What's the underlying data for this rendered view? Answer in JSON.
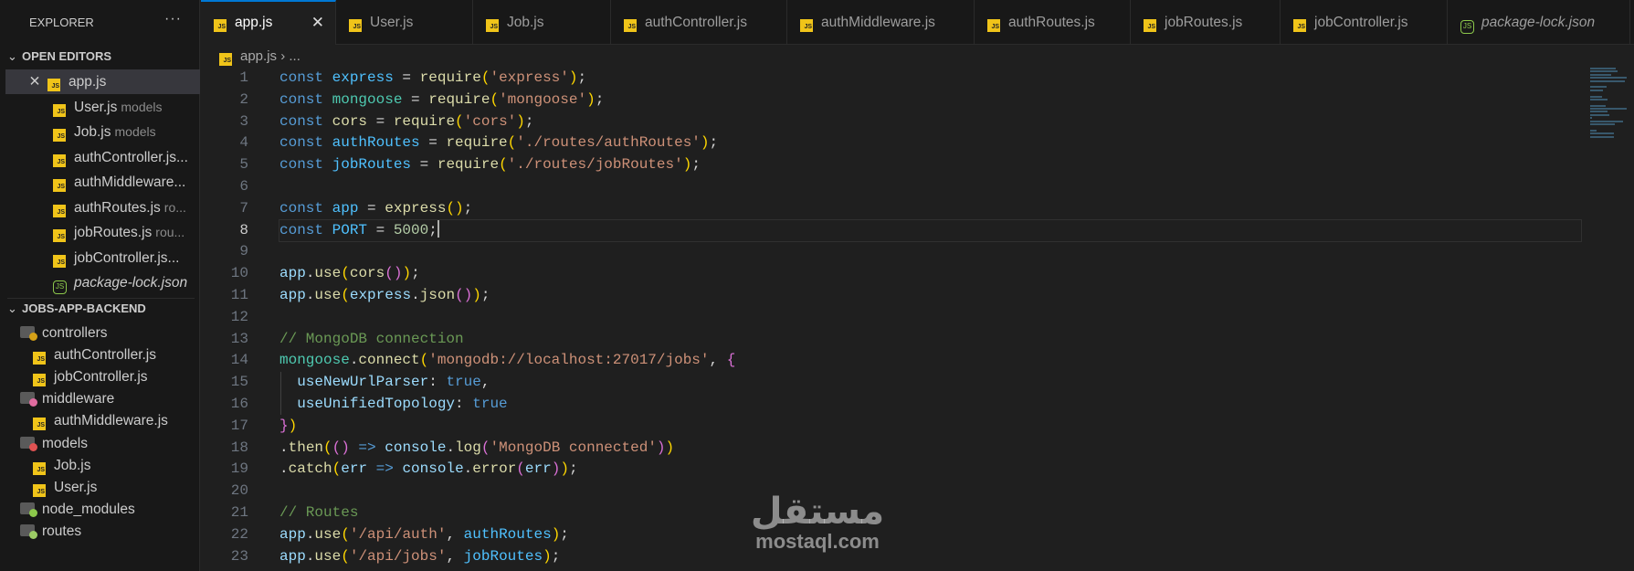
{
  "sidebar": {
    "title": "EXPLORER",
    "more": "···",
    "open_editors": {
      "label": "OPEN EDITORS",
      "items": [
        {
          "name": "app.js",
          "desc": "",
          "icon": "js",
          "selected": true
        },
        {
          "name": "User.js",
          "desc": "models",
          "icon": "js"
        },
        {
          "name": "Job.js",
          "desc": "models",
          "icon": "js"
        },
        {
          "name": "authController.js...",
          "desc": "",
          "icon": "js"
        },
        {
          "name": "authMiddleware...",
          "desc": "",
          "icon": "js"
        },
        {
          "name": "authRoutes.js",
          "desc": "ro...",
          "icon": "js"
        },
        {
          "name": "jobRoutes.js",
          "desc": "rou...",
          "icon": "js"
        },
        {
          "name": "jobController.js...",
          "desc": "",
          "icon": "js"
        },
        {
          "name": "package-lock.json",
          "desc": "",
          "icon": "node",
          "italic": true
        }
      ]
    },
    "project": {
      "label": "JOBS-APP-BACKEND",
      "items": [
        {
          "name": "controllers",
          "type": "folder",
          "badge": "#d4a017",
          "depth": 0
        },
        {
          "name": "authController.js",
          "type": "js",
          "depth": 1
        },
        {
          "name": "jobController.js",
          "type": "js",
          "depth": 1
        },
        {
          "name": "middleware",
          "type": "folder",
          "badge": "#e06c9f",
          "depth": 0
        },
        {
          "name": "authMiddleware.js",
          "type": "js",
          "depth": 1
        },
        {
          "name": "models",
          "type": "folder",
          "badge": "#e05252",
          "depth": 0
        },
        {
          "name": "Job.js",
          "type": "js",
          "depth": 1
        },
        {
          "name": "User.js",
          "type": "js",
          "depth": 1
        },
        {
          "name": "node_modules",
          "type": "folder",
          "badge": "#8cc84b",
          "depth": 0
        },
        {
          "name": "routes",
          "type": "folder",
          "badge": "#9ccc65",
          "depth": 0
        }
      ]
    }
  },
  "tabs": [
    {
      "label": "app.js",
      "icon": "js",
      "active": true
    },
    {
      "label": "User.js",
      "icon": "js"
    },
    {
      "label": "Job.js",
      "icon": "js"
    },
    {
      "label": "authController.js",
      "icon": "js"
    },
    {
      "label": "authMiddleware.js",
      "icon": "js"
    },
    {
      "label": "authRoutes.js",
      "icon": "js"
    },
    {
      "label": "jobRoutes.js",
      "icon": "js"
    },
    {
      "label": "jobController.js",
      "icon": "js"
    },
    {
      "label": "package-lock.json",
      "icon": "node",
      "italic": true
    }
  ],
  "breadcrumb": {
    "file": "app.js",
    "sep": "›",
    "rest": "..."
  },
  "editor": {
    "current_line": 8,
    "lines": [
      [
        [
          "const ",
          "kw"
        ],
        [
          "express",
          "cv"
        ],
        [
          " = ",
          "pl"
        ],
        [
          "require",
          "fn"
        ],
        [
          "(",
          "p1"
        ],
        [
          "'express'",
          "st"
        ],
        [
          ")",
          "p1"
        ],
        [
          ";",
          "pl"
        ]
      ],
      [
        [
          "const ",
          "kw"
        ],
        [
          "mongoose",
          "cl"
        ],
        [
          " = ",
          "pl"
        ],
        [
          "require",
          "fn"
        ],
        [
          "(",
          "p1"
        ],
        [
          "'mongoose'",
          "st"
        ],
        [
          ")",
          "p1"
        ],
        [
          ";",
          "pl"
        ]
      ],
      [
        [
          "const ",
          "kw"
        ],
        [
          "cors",
          "fn"
        ],
        [
          " = ",
          "pl"
        ],
        [
          "require",
          "fn"
        ],
        [
          "(",
          "p1"
        ],
        [
          "'cors'",
          "st"
        ],
        [
          ")",
          "p1"
        ],
        [
          ";",
          "pl"
        ]
      ],
      [
        [
          "const ",
          "kw"
        ],
        [
          "authRoutes",
          "cv"
        ],
        [
          " = ",
          "pl"
        ],
        [
          "require",
          "fn"
        ],
        [
          "(",
          "p1"
        ],
        [
          "'./routes/authRoutes'",
          "st"
        ],
        [
          ")",
          "p1"
        ],
        [
          ";",
          "pl"
        ]
      ],
      [
        [
          "const ",
          "kw"
        ],
        [
          "jobRoutes",
          "cv"
        ],
        [
          " = ",
          "pl"
        ],
        [
          "require",
          "fn"
        ],
        [
          "(",
          "p1"
        ],
        [
          "'./routes/jobRoutes'",
          "st"
        ],
        [
          ")",
          "p1"
        ],
        [
          ";",
          "pl"
        ]
      ],
      [],
      [
        [
          "const ",
          "kw"
        ],
        [
          "app",
          "cv"
        ],
        [
          " = ",
          "pl"
        ],
        [
          "express",
          "fn"
        ],
        [
          "()",
          "p1"
        ],
        [
          ";",
          "pl"
        ]
      ],
      [
        [
          "const ",
          "kw"
        ],
        [
          "PORT",
          "cv"
        ],
        [
          " = ",
          "pl"
        ],
        [
          "5000",
          "nu"
        ],
        [
          ";",
          "pl"
        ]
      ],
      [],
      [
        [
          "app",
          "va"
        ],
        [
          ".",
          "pl"
        ],
        [
          "use",
          "fn"
        ],
        [
          "(",
          "p1"
        ],
        [
          "cors",
          "fn"
        ],
        [
          "()",
          "p2"
        ],
        [
          ")",
          "p1"
        ],
        [
          ";",
          "pl"
        ]
      ],
      [
        [
          "app",
          "va"
        ],
        [
          ".",
          "pl"
        ],
        [
          "use",
          "fn"
        ],
        [
          "(",
          "p1"
        ],
        [
          "express",
          "va"
        ],
        [
          ".",
          "pl"
        ],
        [
          "json",
          "fn"
        ],
        [
          "()",
          "p2"
        ],
        [
          ")",
          "p1"
        ],
        [
          ";",
          "pl"
        ]
      ],
      [],
      [
        [
          "// MongoDB connection",
          "cm"
        ]
      ],
      [
        [
          "mongoose",
          "cl"
        ],
        [
          ".",
          "pl"
        ],
        [
          "connect",
          "fn"
        ],
        [
          "(",
          "p1"
        ],
        [
          "'mongodb://localhost:27017/jobs'",
          "st"
        ],
        [
          ", ",
          "pl"
        ],
        [
          "{",
          "p2"
        ]
      ],
      [
        [
          "  useNewUrlParser",
          "va"
        ],
        [
          ": ",
          "pl"
        ],
        [
          "true",
          "kw"
        ],
        [
          ",",
          "pl"
        ]
      ],
      [
        [
          "  useUnifiedTopology",
          "va"
        ],
        [
          ": ",
          "pl"
        ],
        [
          "true",
          "kw"
        ]
      ],
      [
        [
          "}",
          "p2"
        ],
        [
          ")",
          "p1"
        ]
      ],
      [
        [
          ".",
          "pl"
        ],
        [
          "then",
          "fn"
        ],
        [
          "(",
          "p1"
        ],
        [
          "()",
          "p2"
        ],
        [
          " => ",
          "kw"
        ],
        [
          "console",
          "va"
        ],
        [
          ".",
          "pl"
        ],
        [
          "log",
          "fn"
        ],
        [
          "(",
          "p2"
        ],
        [
          "'MongoDB connected'",
          "st"
        ],
        [
          ")",
          "p2"
        ],
        [
          ")",
          "p1"
        ]
      ],
      [
        [
          ".",
          "pl"
        ],
        [
          "catch",
          "fn"
        ],
        [
          "(",
          "p1"
        ],
        [
          "err",
          "va"
        ],
        [
          " => ",
          "kw"
        ],
        [
          "console",
          "va"
        ],
        [
          ".",
          "pl"
        ],
        [
          "error",
          "fn"
        ],
        [
          "(",
          "p2"
        ],
        [
          "err",
          "va"
        ],
        [
          ")",
          "p2"
        ],
        [
          ")",
          "p1"
        ],
        [
          ";",
          "pl"
        ]
      ],
      [],
      [
        [
          "// Routes",
          "cm"
        ]
      ],
      [
        [
          "app",
          "va"
        ],
        [
          ".",
          "pl"
        ],
        [
          "use",
          "fn"
        ],
        [
          "(",
          "p1"
        ],
        [
          "'/api/auth'",
          "st"
        ],
        [
          ", ",
          "pl"
        ],
        [
          "authRoutes",
          "cv"
        ],
        [
          ")",
          "p1"
        ],
        [
          ";",
          "pl"
        ]
      ],
      [
        [
          "app",
          "va"
        ],
        [
          ".",
          "pl"
        ],
        [
          "use",
          "fn"
        ],
        [
          "(",
          "p1"
        ],
        [
          "'/api/jobs'",
          "st"
        ],
        [
          ", ",
          "pl"
        ],
        [
          "jobRoutes",
          "cv"
        ],
        [
          ")",
          "p1"
        ],
        [
          ";",
          "pl"
        ]
      ]
    ]
  },
  "watermark": {
    "arabic": "مستقل",
    "latin": "mostaql.com"
  }
}
